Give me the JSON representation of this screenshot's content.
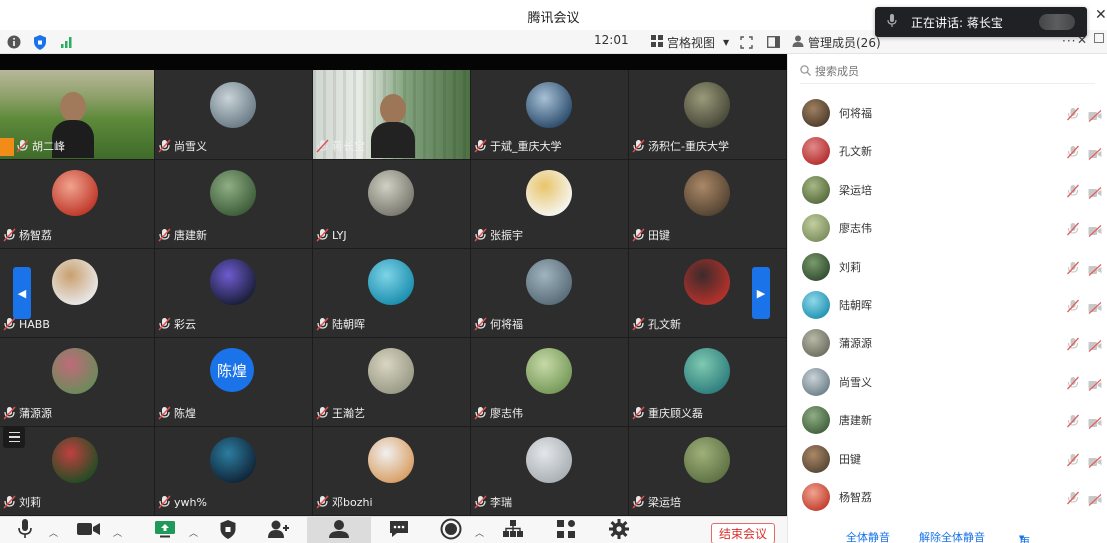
{
  "window": {
    "title": "腾讯会议"
  },
  "toolbar": {
    "time": "12:01",
    "view_label": "宫格视图",
    "members_label": "管理成员(26)",
    "more": "···",
    "panel_close": "✕",
    "window_close": "✕",
    "signal_color": "#27ae60"
  },
  "toast": {
    "text": "正在讲话: 蒋长宝"
  },
  "tiles": [
    {
      "name": "胡二峰"
    },
    {
      "name": "尚雪义"
    },
    {
      "name": "蒋长宝"
    },
    {
      "name": "于斌_重庆大学"
    },
    {
      "name": "汤积仁-重庆大学"
    },
    {
      "name": "杨智荔"
    },
    {
      "name": "唐建新"
    },
    {
      "name": "LYJ"
    },
    {
      "name": "张振宇"
    },
    {
      "name": "田键"
    },
    {
      "name": "HABB"
    },
    {
      "name": "彩云"
    },
    {
      "name": "陆朝晖"
    },
    {
      "name": "何将福"
    },
    {
      "name": "孔文新"
    },
    {
      "name": "蒲源源"
    },
    {
      "name": "陈煌",
      "avatar_text": "陈煌"
    },
    {
      "name": "王瀚艺"
    },
    {
      "name": "廖志伟"
    },
    {
      "name": "重庆顾义磊"
    },
    {
      "name": "刘莉"
    },
    {
      "name": "ywh%"
    },
    {
      "name": "邓bozhi"
    },
    {
      "name": "李瑞"
    },
    {
      "name": "梁运培"
    }
  ],
  "bottombar": {
    "end_label": "结束会议"
  },
  "panel": {
    "search_placeholder": "搜索成员",
    "members": [
      {
        "name": "何将福"
      },
      {
        "name": "孔文新"
      },
      {
        "name": "梁运培"
      },
      {
        "name": "廖志伟"
      },
      {
        "name": "刘莉"
      },
      {
        "name": "陆朝晖"
      },
      {
        "name": "蒲源源"
      },
      {
        "name": "尚雪义"
      },
      {
        "name": "唐建新"
      },
      {
        "name": "田键"
      },
      {
        "name": "杨智荔"
      }
    ],
    "mute_all": "全体静音",
    "unmute_all": "解除全体静音",
    "more": "更多"
  },
  "colors": {
    "accent": "#1a73e8",
    "end_red": "#d9302c",
    "host_orange": "#f28c18"
  }
}
